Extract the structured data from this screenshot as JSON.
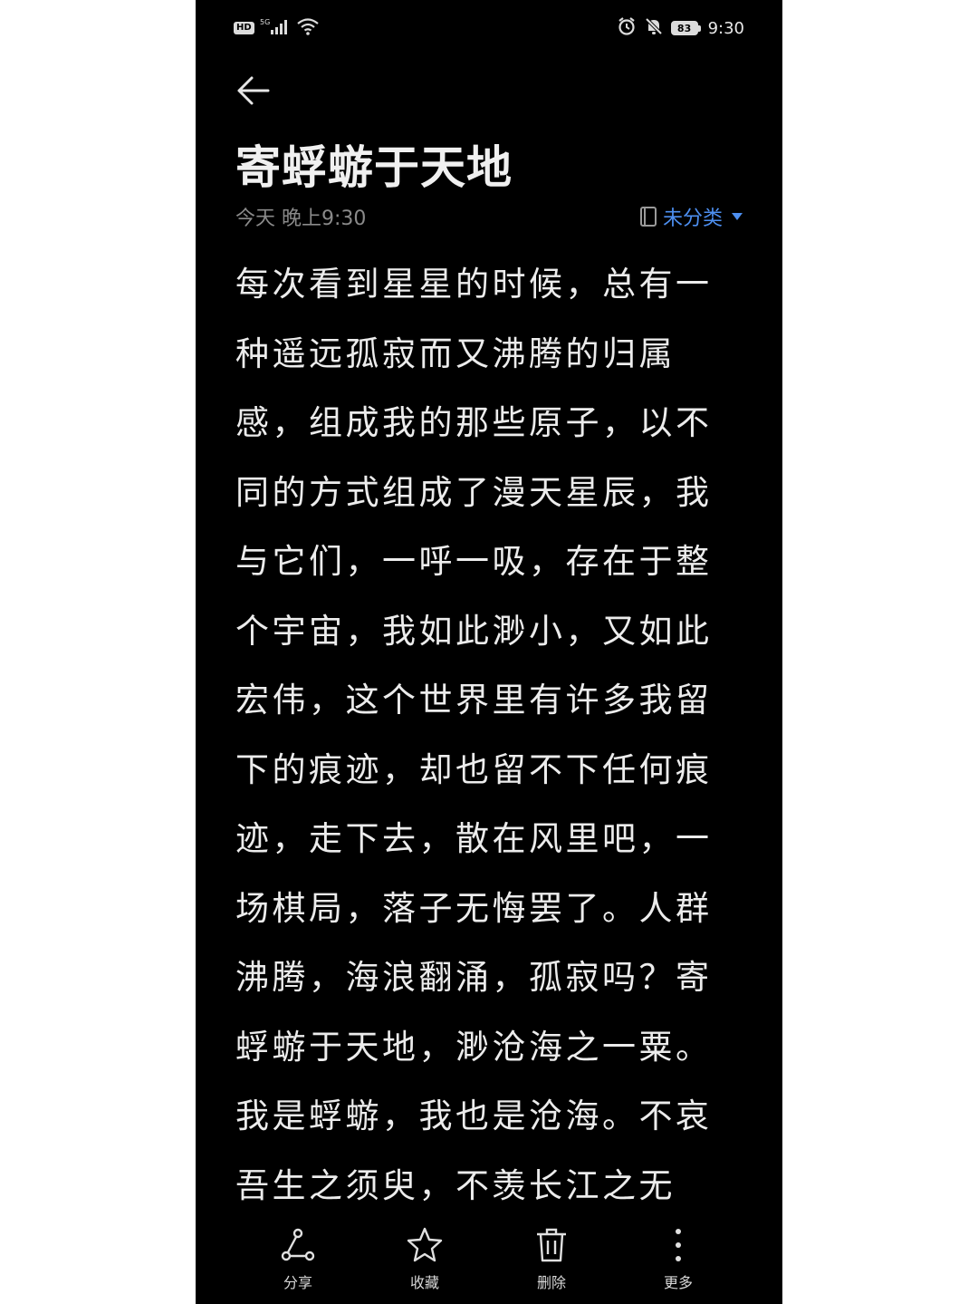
{
  "status_bar": {
    "hd": "HD",
    "network": "5G",
    "battery": "83",
    "time": "9:30"
  },
  "note": {
    "title": "寄蜉蝣于天地",
    "date": "今天 晚上9:30",
    "category": "未分类",
    "body_lines": [
      "每次看到星星的时候，总有一",
      "种遥远孤寂而又沸腾的归属",
      "感，组成我的那些原子，以不",
      "同的方式组成了漫天星辰，我",
      "与它们，一呼一吸，存在于整",
      "个宇宙，我如此渺小，又如此",
      "宏伟，这个世界里有许多我留",
      "下的痕迹，却也留不下任何痕",
      "迹，走下去，散在风里吧，一",
      "场棋局，落子无悔罢了。人群",
      "沸腾，海浪翻涌，孤寂吗？寄",
      "蜉蝣于天地，渺沧海之一粟。",
      "我是蜉蝣，我也是沧海。不哀",
      "吾生之须臾，不羡长江之无"
    ]
  },
  "toolbar": {
    "share": "分享",
    "favorite": "收藏",
    "delete": "删除",
    "more": "更多"
  },
  "colors": {
    "background": "#000000",
    "text": "#ececec",
    "meta": "#8a8a8a",
    "accent": "#4d8ff0"
  }
}
